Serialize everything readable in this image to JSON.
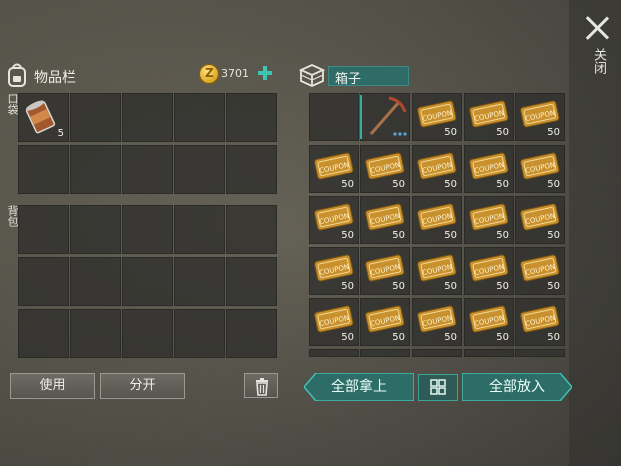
{
  "close": {
    "label": "关闭",
    "icon": "close-icon"
  },
  "inventory": {
    "title": "物品栏",
    "gold": "3701",
    "pocket_label": "口袋",
    "backpack_label": "背包",
    "items": [
      {
        "name": "canned-food",
        "qty": "5"
      }
    ],
    "buttons": {
      "use": "使用",
      "split": "分开",
      "trash_icon": "trash-icon"
    }
  },
  "chest": {
    "title": "箱子",
    "item_label": "COUPON",
    "coupon_qty": "50",
    "slot_count": 24,
    "buttons": {
      "take_all": "全部拿上",
      "put_all": "全部放入",
      "sort_icon": "grid-sort-icon"
    }
  },
  "colors": {
    "accent": "#2fb0a4",
    "gold": "#d6a21c",
    "slot": "#2e2e2b"
  }
}
